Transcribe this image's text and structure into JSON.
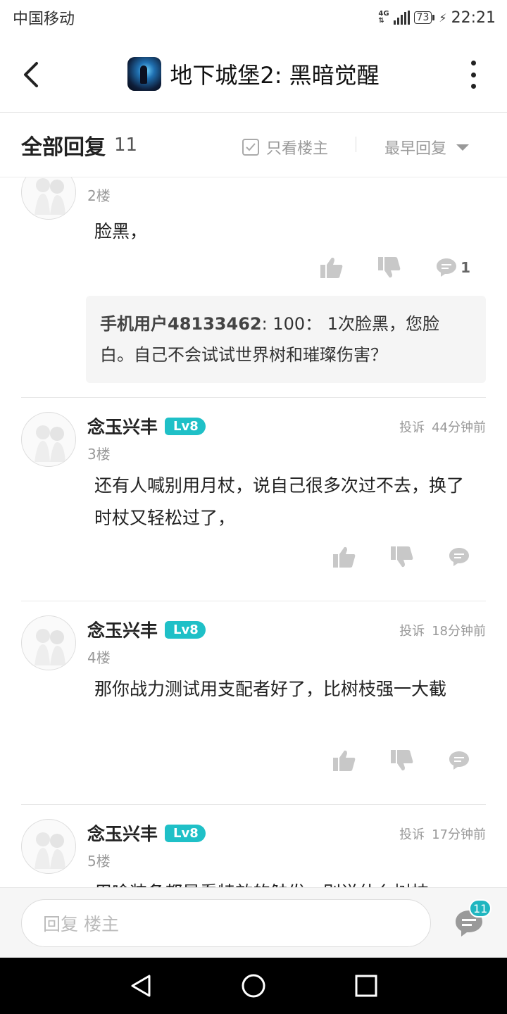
{
  "status_bar": {
    "carrier": "中国移动",
    "network": "4G",
    "battery": "73",
    "time": "22:21"
  },
  "nav": {
    "title": "地下城堡2: 黑暗觉醒"
  },
  "reply_header": {
    "title": "全部回复",
    "count": "11",
    "only_owner_label": "只看楼主",
    "sort_label": "最早回复"
  },
  "posts": [
    {
      "floor": "2楼",
      "text": "脸黑，",
      "comment_count": "1",
      "sub_reply": {
        "user": "手机用户48133462",
        "text": ": 100： 1次脸黑，您脸白。自己不会试试世界树和璀璨伤害？"
      }
    },
    {
      "username": "念玉兴丰",
      "level": "Lv8",
      "report": "投诉",
      "time": "44分钟前",
      "floor": "3楼",
      "text": "还有人喊别用月杖，说自己很多次过不去，换了时杖又轻松过了，"
    },
    {
      "username": "念玉兴丰",
      "level": "Lv8",
      "report": "投诉",
      "time": "18分钟前",
      "floor": "4楼",
      "text": "那你战力测试用支配者好了，比树枝强一大截"
    },
    {
      "username": "念玉兴丰",
      "level": "Lv8",
      "report": "投诉",
      "time": "17分钟前",
      "floor": "5楼",
      "text": "用啥装备都是看特效的触发，别说什么树枝"
    }
  ],
  "bottom_bar": {
    "reply_placeholder": "回复  楼主",
    "comment_badge": "11"
  }
}
